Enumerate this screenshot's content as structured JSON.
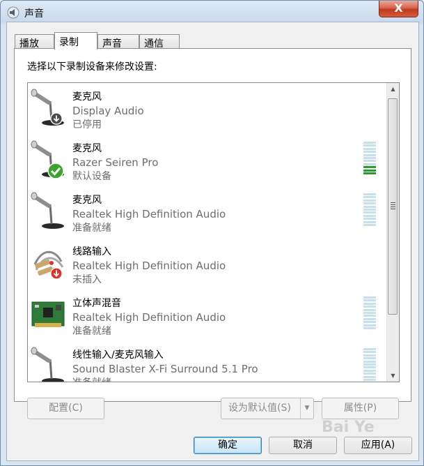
{
  "window": {
    "title": "声音",
    "close_glyph": "X"
  },
  "tabs": [
    {
      "label": "播放",
      "active": false
    },
    {
      "label": "录制",
      "active": true
    },
    {
      "label": "声音",
      "active": false
    },
    {
      "label": "通信",
      "active": false
    }
  ],
  "instruction": "选择以下录制设备来修改设置:",
  "devices": [
    {
      "name": "麦克风",
      "description": "Display Audio",
      "status": "已停用",
      "icon": "microphone-icon",
      "badge": "disabled-badge",
      "meter_level": null
    },
    {
      "name": "麦克风",
      "description": "Razer Seiren Pro",
      "status": "默认设备",
      "icon": "microphone-icon",
      "badge": "default-checkmark-badge",
      "meter_level": 0.3
    },
    {
      "name": "麦克风",
      "description": "Realtek High Definition Audio",
      "status": "准备就绪",
      "icon": "microphone-icon",
      "badge": null,
      "meter_level": 0
    },
    {
      "name": "线路输入",
      "description": "Realtek High Definition Audio",
      "status": "未插入",
      "icon": "line-in-cable-icon",
      "badge": "unplugged-badge",
      "meter_level": null
    },
    {
      "name": "立体声混音",
      "description": "Realtek High Definition Audio",
      "status": "准备就绪",
      "icon": "sound-card-icon",
      "badge": null,
      "meter_level": 0
    },
    {
      "name": "线性输入/麦克风输入",
      "description": "Sound Blaster X-Fi Surround 5.1 Pro",
      "status": "准备就绪",
      "icon": "microphone-icon",
      "badge": null,
      "meter_level": 0
    }
  ],
  "buttons": {
    "configure": "配置(C)",
    "set_default": "设为默认值(S)",
    "properties": "属性(P)",
    "ok": "确定",
    "cancel": "取消",
    "apply": "应用(A)"
  },
  "watermark": "Bai Ye",
  "colors": {
    "meter_active": "#2d9a2d",
    "meter_idle": "#c7e0ec",
    "close_button": "#c0391f"
  }
}
